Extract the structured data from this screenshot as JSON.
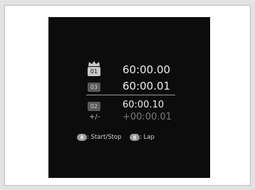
{
  "stopwatch": {
    "rows": [
      {
        "badge": "01",
        "time": "60:00.00"
      },
      {
        "badge": "03",
        "time": "60:00.01"
      },
      {
        "badge": "02",
        "time": "60:00.10"
      }
    ],
    "diff_label": "+/-",
    "diff_time": "+00:00.01",
    "legend": {
      "start_stop": ": Start/Stop",
      "lap": ": Lap"
    }
  },
  "colors": {
    "screen_bg": "#0c0c0c",
    "text": "#ececec",
    "dim_text": "#7a7a7a"
  }
}
